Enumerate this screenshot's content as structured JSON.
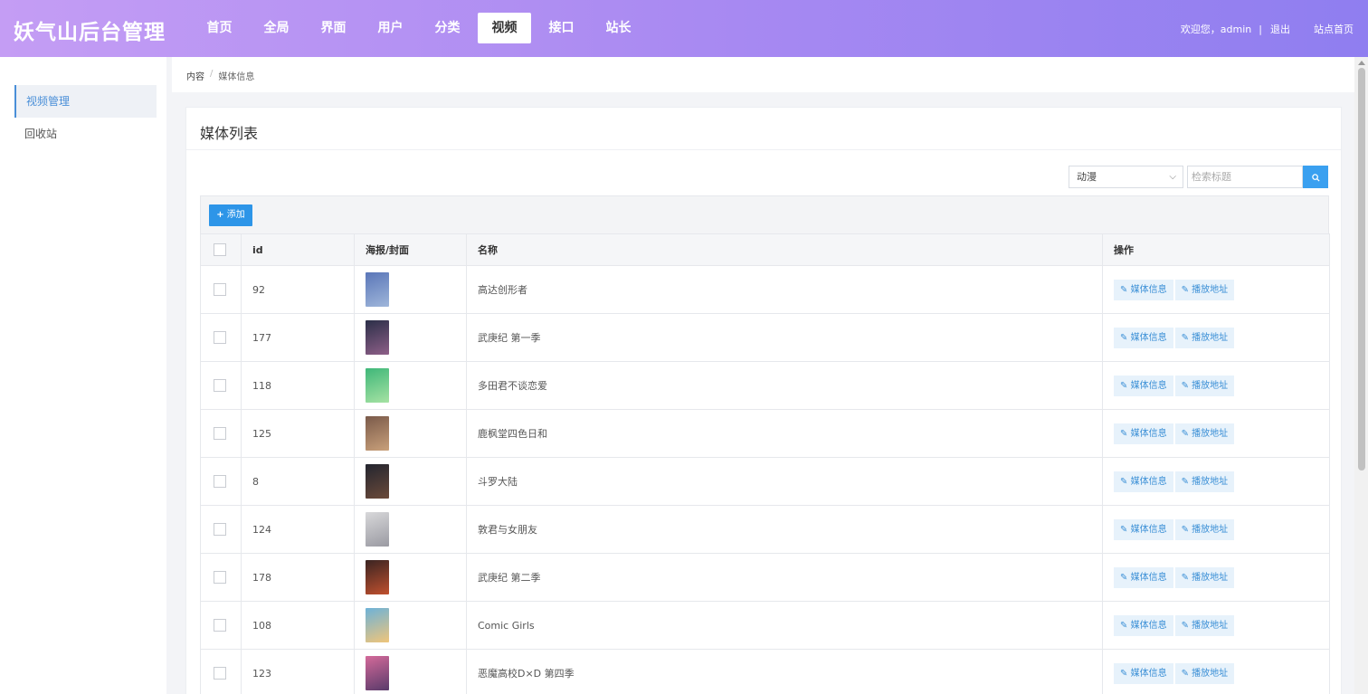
{
  "header": {
    "brand": "妖气山后台管理",
    "nav": [
      "首页",
      "全局",
      "界面",
      "用户",
      "分类",
      "视频",
      "接口",
      "站长"
    ],
    "active_nav": "视频",
    "welcome": "欢迎您，admin",
    "logout": "退出",
    "site_home": "站点首页"
  },
  "sidebar": {
    "items": [
      {
        "label": "视频管理",
        "active": true
      },
      {
        "label": "回收站",
        "active": false
      }
    ]
  },
  "breadcrumb": {
    "root": "内容",
    "current": "媒体信息"
  },
  "card": {
    "title": "媒体列表",
    "filter_value": "动漫",
    "search_placeholder": "检索标题",
    "add_label": "添加"
  },
  "table": {
    "headers": {
      "id": "id",
      "poster": "海报/封面",
      "name": "名称",
      "ops": "操作"
    },
    "op_labels": {
      "info": "媒体信息",
      "play": "播放地址"
    },
    "rows": [
      {
        "id": "92",
        "name": "高达创形者",
        "poster_colors": [
          "#5a76b8",
          "#9fb6da"
        ]
      },
      {
        "id": "177",
        "name": "武庚纪 第一季",
        "poster_colors": [
          "#2b2f48",
          "#8e5f88"
        ]
      },
      {
        "id": "118",
        "name": "多田君不谈恋爱",
        "poster_colors": [
          "#3fb779",
          "#a6e2a3"
        ]
      },
      {
        "id": "125",
        "name": "鹿枫堂四色日和",
        "poster_colors": [
          "#7a5a4a",
          "#c9a07a"
        ]
      },
      {
        "id": "8",
        "name": "斗罗大陆",
        "poster_colors": [
          "#23252f",
          "#6b4a3a"
        ]
      },
      {
        "id": "124",
        "name": "敦君与女朋友",
        "poster_colors": [
          "#d8d8da",
          "#9a9aa2"
        ]
      },
      {
        "id": "178",
        "name": "武庚纪 第二季",
        "poster_colors": [
          "#3a2422",
          "#c0502e"
        ]
      },
      {
        "id": "108",
        "name": "Comic Girls",
        "poster_colors": [
          "#6db2d8",
          "#f0c57a"
        ]
      },
      {
        "id": "123",
        "name": "恶魔高校D×D 第四季",
        "poster_colors": [
          "#d46a9a",
          "#5a3a6a"
        ]
      }
    ]
  }
}
